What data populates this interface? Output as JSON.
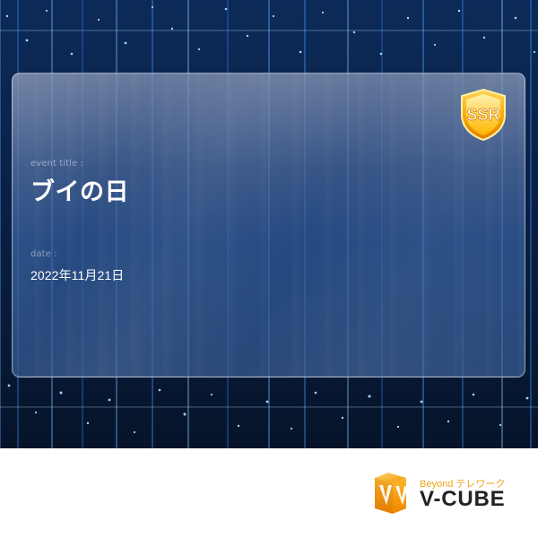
{
  "card": {
    "event_label": "event title :",
    "event_title": "ブイの日",
    "date_label": "date :",
    "date_value": "2022年11月21日"
  },
  "badge": {
    "text": "SSR"
  },
  "brand": {
    "tagline": "Beyond テレワーク",
    "name": "V-CUBE"
  }
}
